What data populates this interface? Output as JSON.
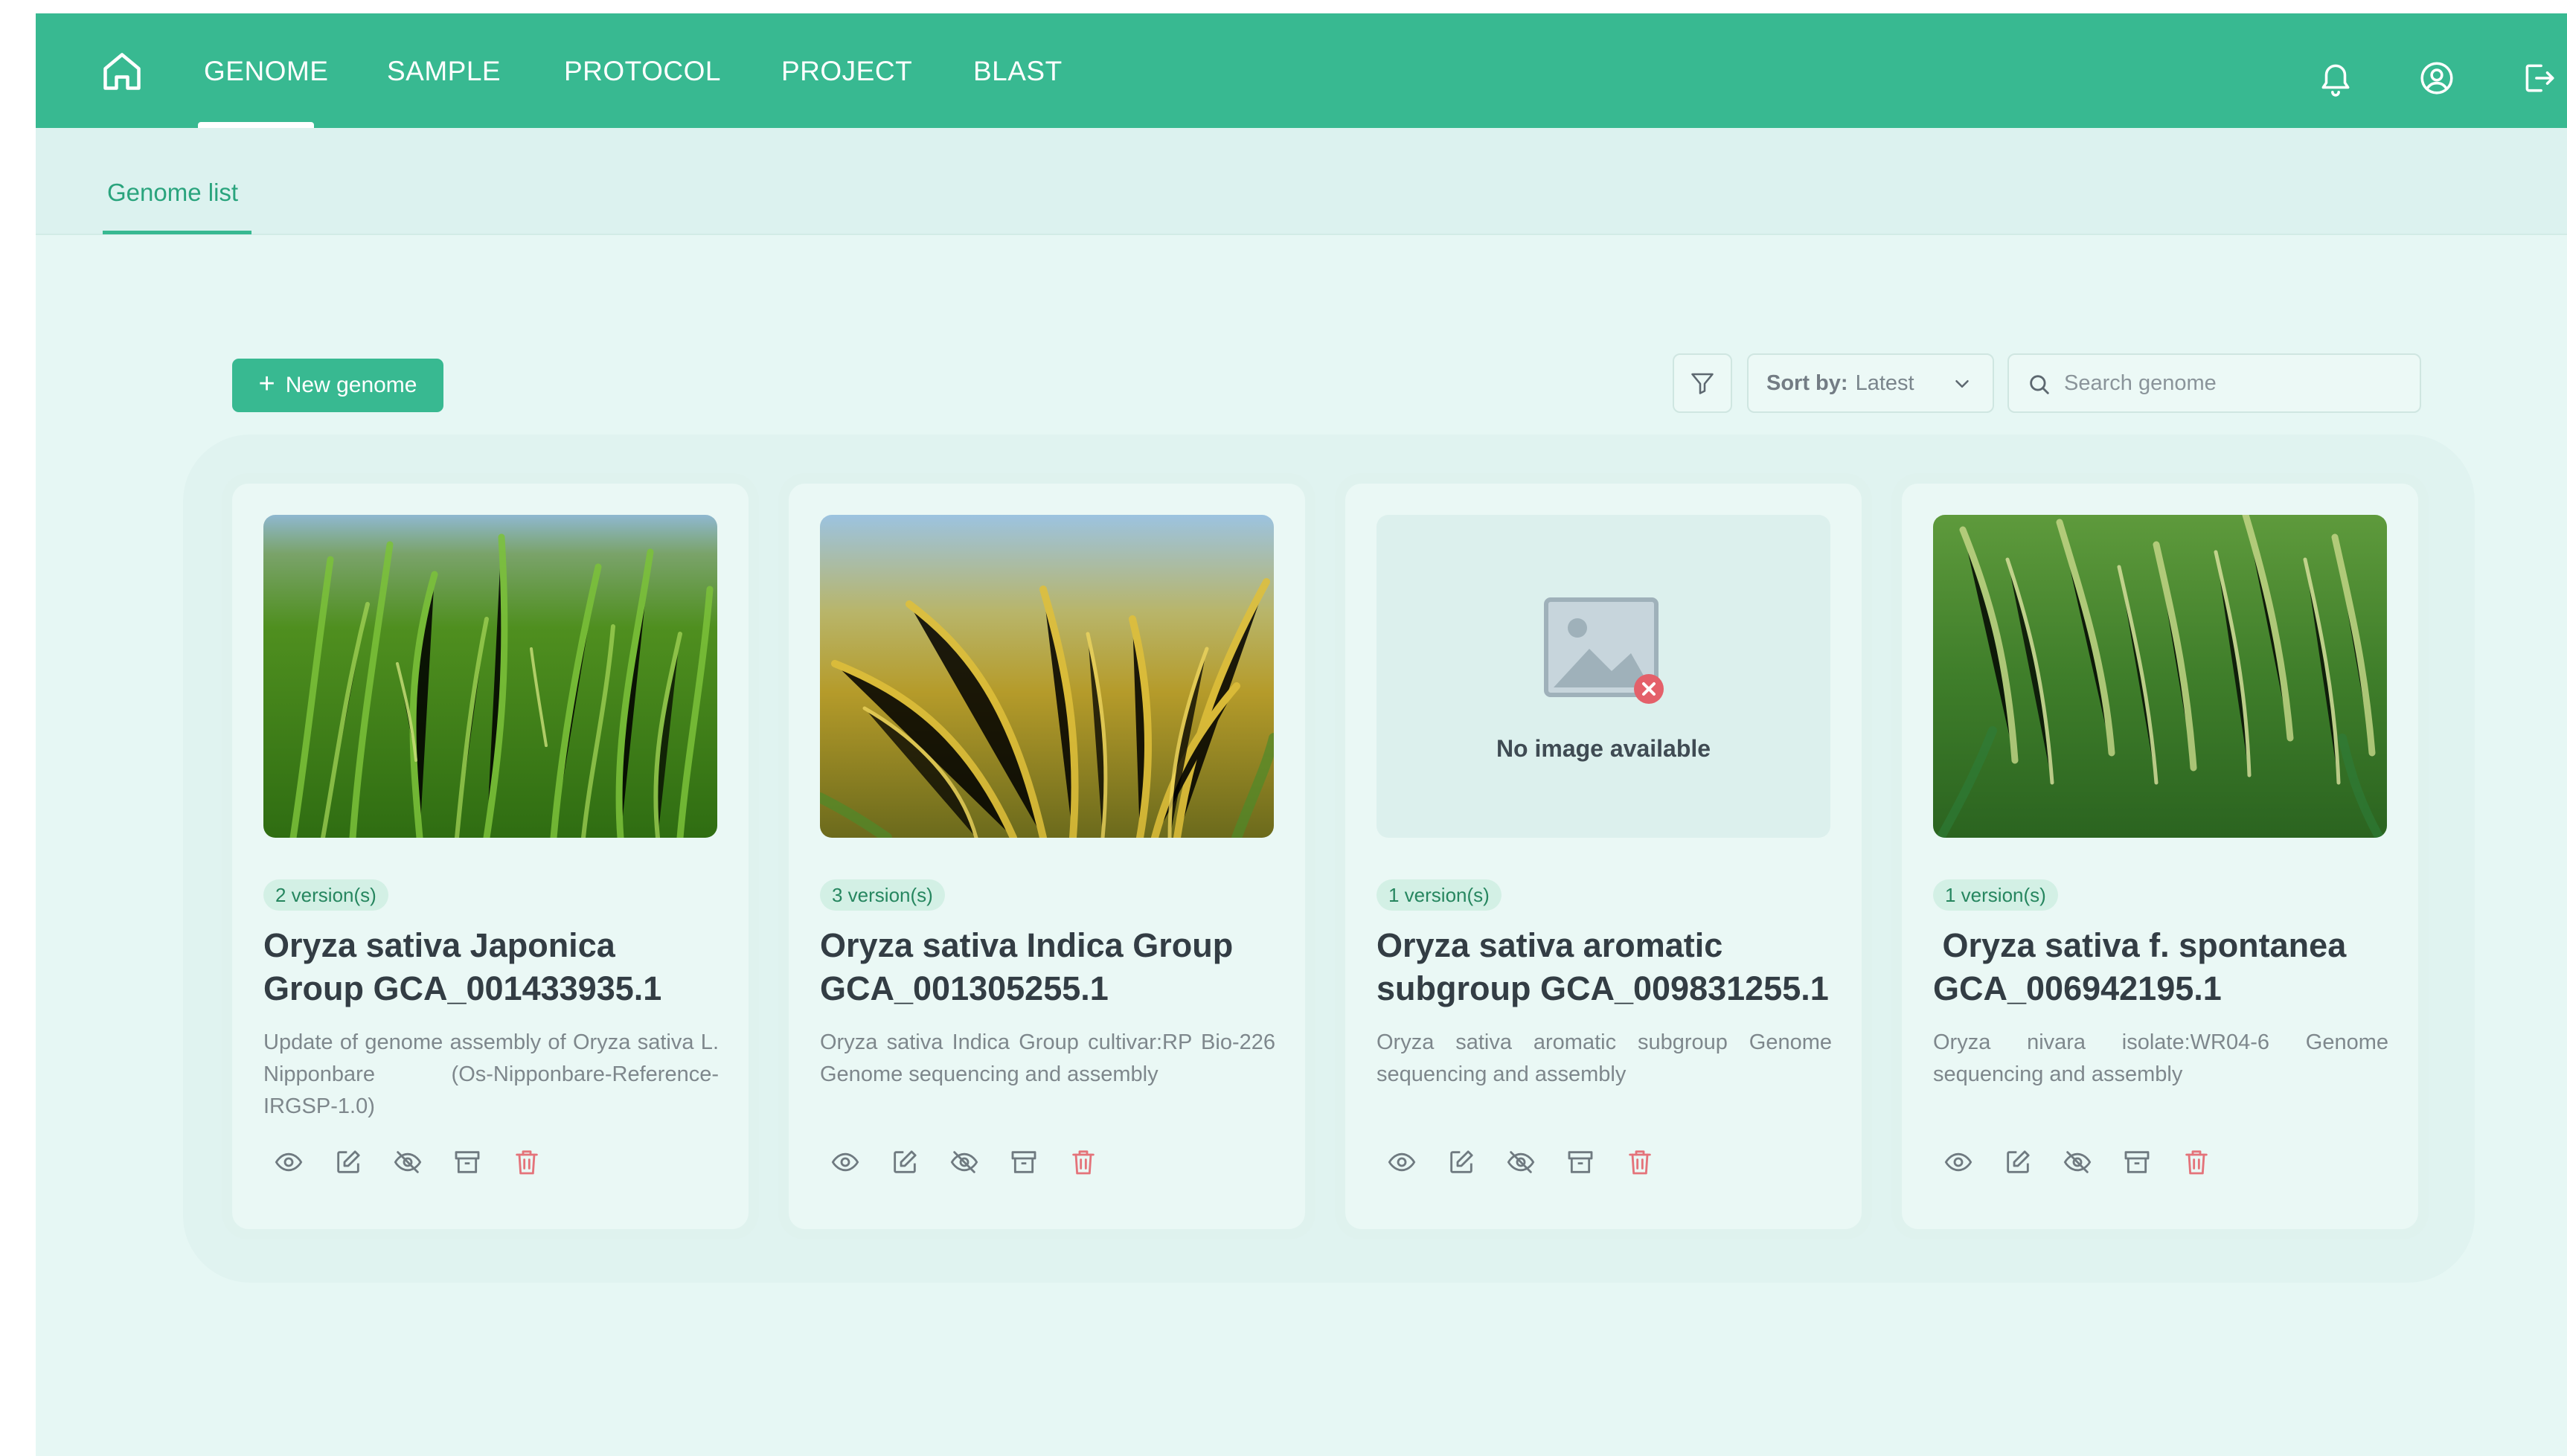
{
  "nav": {
    "tabs": [
      {
        "label": "GENOME"
      },
      {
        "label": "SAMPLE"
      },
      {
        "label": "PROTOCOL"
      },
      {
        "label": "PROJECT"
      },
      {
        "label": "BLAST"
      }
    ],
    "active_tab": "GENOME",
    "icons": [
      "home-icon",
      "bell-icon",
      "user-circle-icon",
      "logout-icon"
    ]
  },
  "subnav": {
    "tab": "Genome list"
  },
  "toolbar": {
    "new_button": "New genome",
    "sort_label": "Sort by:",
    "sort_value": "Latest",
    "search_placeholder": "Search genome"
  },
  "no_image_text": "No image available",
  "cards": [
    {
      "versions": "2 version(s)",
      "title": "Oryza sativa Japonica Group GCA_001433935.1",
      "description": "Update of genome assembly of Oryza sativa L. Nipponbare (Os-Nipponbare-Reference-IRGSP-1.0)",
      "image": "green rice field photo"
    },
    {
      "versions": "3 version(s)",
      "title": "Oryza sativa Indica Group GCA_001305255.1",
      "description": "Oryza sativa Indica Group cultivar:RP Bio-226 Genome sequencing and assembly",
      "image": "golden rice panicles photo"
    },
    {
      "versions": "1 version(s)",
      "title": "Oryza sativa aromatic subgroup GCA_009831255.1",
      "description": "Oryza sativa aromatic subgroup Genome sequencing and assembly",
      "image": "none"
    },
    {
      "versions": "1 version(s)",
      "title": " Oryza sativa f. spontanea GCA_006942195.1",
      "description": "Oryza nivara isolate:WR04-6 Genome sequencing and assembly",
      "image": "ripening rice panicles photo"
    }
  ],
  "card_actions": [
    "eye-icon",
    "edit-icon",
    "eye-off-icon",
    "archive-icon",
    "trash-icon"
  ],
  "colors": {
    "primary": "#38b991",
    "background": "#e6f7f4",
    "danger": "#e4737a",
    "badge_bg": "#d3f0e5"
  }
}
